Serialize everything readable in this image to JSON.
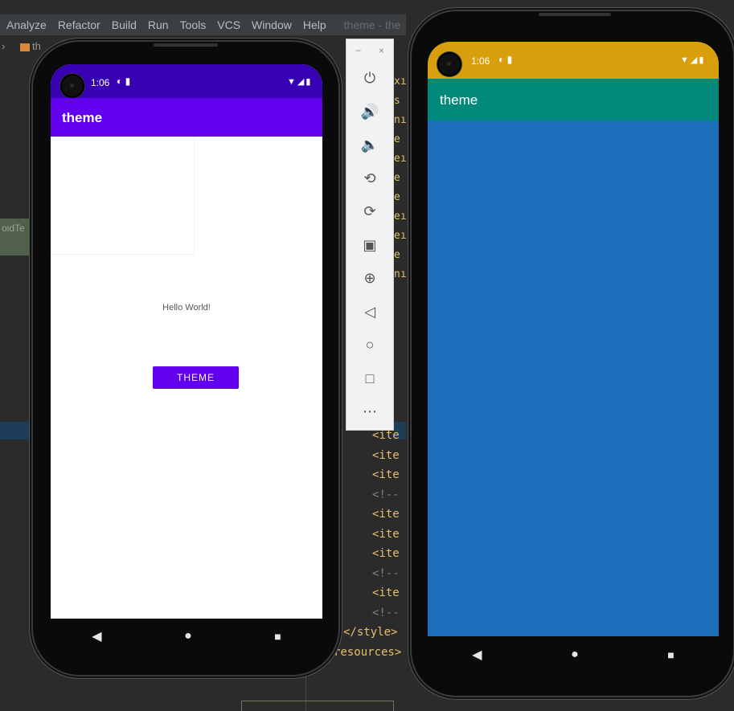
{
  "ide": {
    "menu": [
      "Analyze",
      "Refactor",
      "Build",
      "Run",
      "Tools",
      "VCS",
      "Window",
      "Help"
    ],
    "window_title": "theme - the",
    "breadcrumb": "th",
    "sidebar_tab": "oidTe",
    "code_lines": [
      {
        "text": "<ite",
        "kind": "tag"
      },
      {
        "text": "<ite",
        "kind": "tag"
      },
      {
        "text": "<ite",
        "kind": "tag"
      },
      {
        "text": "<!--",
        "kind": "comment"
      },
      {
        "text": "<ite",
        "kind": "tag"
      },
      {
        "text": "<ite",
        "kind": "tag"
      },
      {
        "text": "<ite",
        "kind": "tag"
      },
      {
        "text": "<!--",
        "kind": "comment"
      },
      {
        "text": "<ite",
        "kind": "tag"
      },
      {
        "text": "<!--",
        "kind": "comment"
      },
      {
        "text": "</style>",
        "kind": "tag"
      },
      {
        "text": "resources>",
        "kind": "tag"
      }
    ],
    "mini_code": [
      "xı",
      "s",
      "nı",
      "e",
      "eı",
      "e",
      "e",
      "eı",
      "eı",
      "e",
      "nı"
    ]
  },
  "phone_left": {
    "status_time": "1:06",
    "status_icons": "▼◢▮",
    "app_title": "theme",
    "hello_text": "Hello World!",
    "theme_button": "THEME",
    "colors": {
      "status": "#3700b3",
      "appbar": "#6200ee",
      "button": "#6200ee"
    }
  },
  "phone_right": {
    "status_time": "1:06",
    "status_icons": "▼◢▮",
    "app_title": "theme",
    "colors": {
      "status": "#d99e0b",
      "appbar": "#00897b",
      "background": "#1b6fba"
    }
  },
  "emulator_toolbar": {
    "minimize": "−",
    "close": "×",
    "buttons": [
      {
        "name": "power",
        "glyph": "⏻"
      },
      {
        "name": "volume-up",
        "glyph": "🔊"
      },
      {
        "name": "volume-down",
        "glyph": "🔈"
      },
      {
        "name": "rotate-left",
        "glyph": "⟲"
      },
      {
        "name": "rotate-right",
        "glyph": "⟳"
      },
      {
        "name": "screenshot",
        "glyph": "▣"
      },
      {
        "name": "zoom",
        "glyph": "⊕"
      },
      {
        "name": "back",
        "glyph": "◁"
      },
      {
        "name": "home",
        "glyph": "○"
      },
      {
        "name": "overview",
        "glyph": "□"
      },
      {
        "name": "more",
        "glyph": "⋯"
      }
    ]
  },
  "nav_glyphs": {
    "back": "◀",
    "home": "●",
    "recents": "■"
  }
}
